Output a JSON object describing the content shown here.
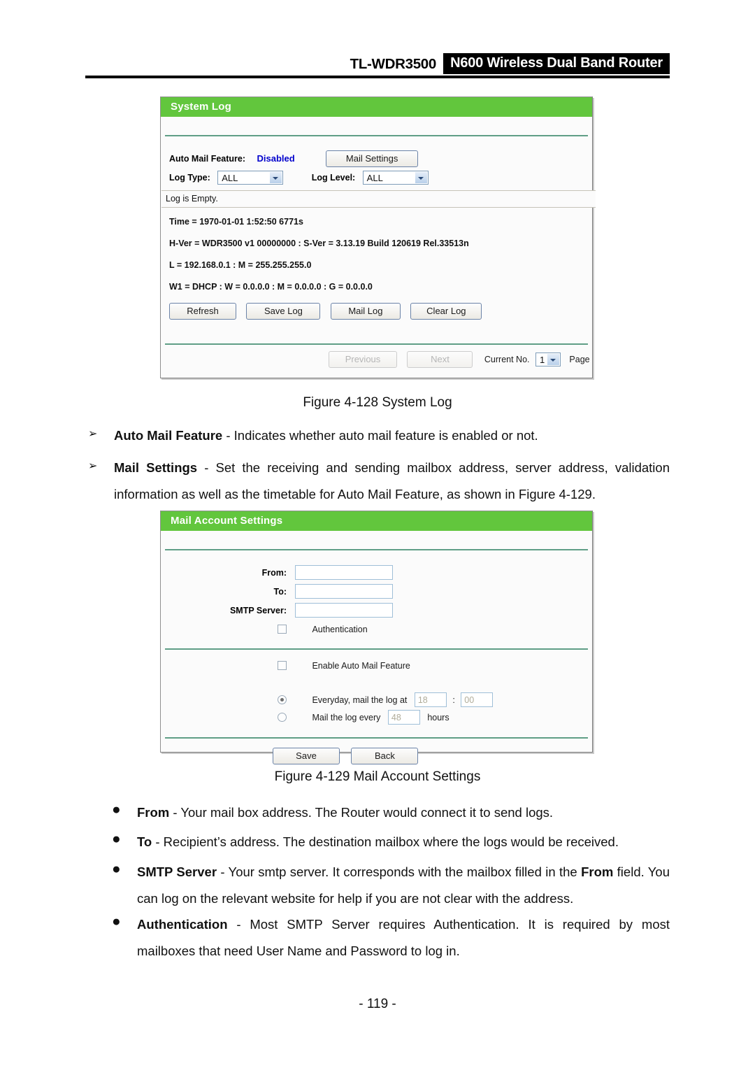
{
  "header": {
    "model": "TL-WDR3500",
    "product_badge": "N600 Wireless Dual Band Router"
  },
  "system_log_panel": {
    "title": "System Log",
    "auto_mail_label": "Auto Mail Feature:",
    "auto_mail_value": "Disabled",
    "mail_settings_button": "Mail Settings",
    "log_type_label": "Log Type:",
    "log_type_value": "ALL",
    "log_level_label": "Log Level:",
    "log_level_value": "ALL",
    "log_empty_text": "Log is Empty.",
    "log_lines": [
      "Time = 1970-01-01 1:52:50 6771s",
      "H-Ver = WDR3500 v1 00000000 : S-Ver = 3.13.19 Build 120619 Rel.33513n",
      "L = 192.168.0.1 : M = 255.255.255.0",
      "W1 = DHCP : W = 0.0.0.0 : M = 0.0.0.0 : G = 0.0.0.0"
    ],
    "buttons": {
      "refresh": "Refresh",
      "save_log": "Save Log",
      "mail_log": "Mail Log",
      "clear_log": "Clear Log"
    },
    "pagination": {
      "previous": "Previous",
      "next": "Next",
      "current_no_label": "Current No.",
      "current_page": "1",
      "page_label": "Page"
    }
  },
  "figure_128_caption": "Figure 4-128 System Log",
  "bullets_after_128": [
    {
      "marker": "➢",
      "term": "Auto Mail Feature",
      "text": " - Indicates whether auto mail feature is enabled or not."
    },
    {
      "marker": "➢",
      "term": "Mail Settings",
      "text": " - Set the receiving and sending mailbox address, server address, validation information as well as the timetable for Auto Mail Feature, as shown in Figure 4-129."
    }
  ],
  "mail_account_panel": {
    "title": "Mail Account Settings",
    "from_label": "From:",
    "from_value": "",
    "to_label": "To:",
    "to_value": "",
    "smtp_label": "SMTP Server:",
    "smtp_value": "",
    "authentication_label": "Authentication",
    "enable_auto_mail_label": "Enable Auto Mail Feature",
    "everyday_label": "Everyday, mail the log at",
    "everyday_hour": "18",
    "time_separator": ":",
    "everyday_minute": "00",
    "interval_label": "Mail the log every",
    "interval_hours": "48",
    "hours_label": "hours",
    "save_button": "Save",
    "back_button": "Back"
  },
  "figure_129_caption": "Figure 4-129 Mail Account Settings",
  "bullets_after_129": [
    {
      "marker": "●",
      "term": "From",
      "text": " - Your mail box address. The Router would connect it to send logs."
    },
    {
      "marker": "●",
      "term": "To",
      "text": " - Recipient’s address. The destination mailbox where the logs would be received."
    },
    {
      "marker": "●",
      "term": "SMTP Server",
      "text_pre": " - Your smtp server. It corresponds with the mailbox filled in the ",
      "term2": "From",
      "text_post": " field. You can log on the relevant website for help if you are not clear with the address."
    },
    {
      "marker": "●",
      "term": "Authentication",
      "text": " - Most SMTP Server requires Authentication. It is required by most mailboxes that need User Name and Password to log in."
    }
  ],
  "page_number": "- 119 -",
  "colors": {
    "panel_green": "#62c63d",
    "value_blue": "#0000cc",
    "divider_green": "#5f9e86"
  }
}
